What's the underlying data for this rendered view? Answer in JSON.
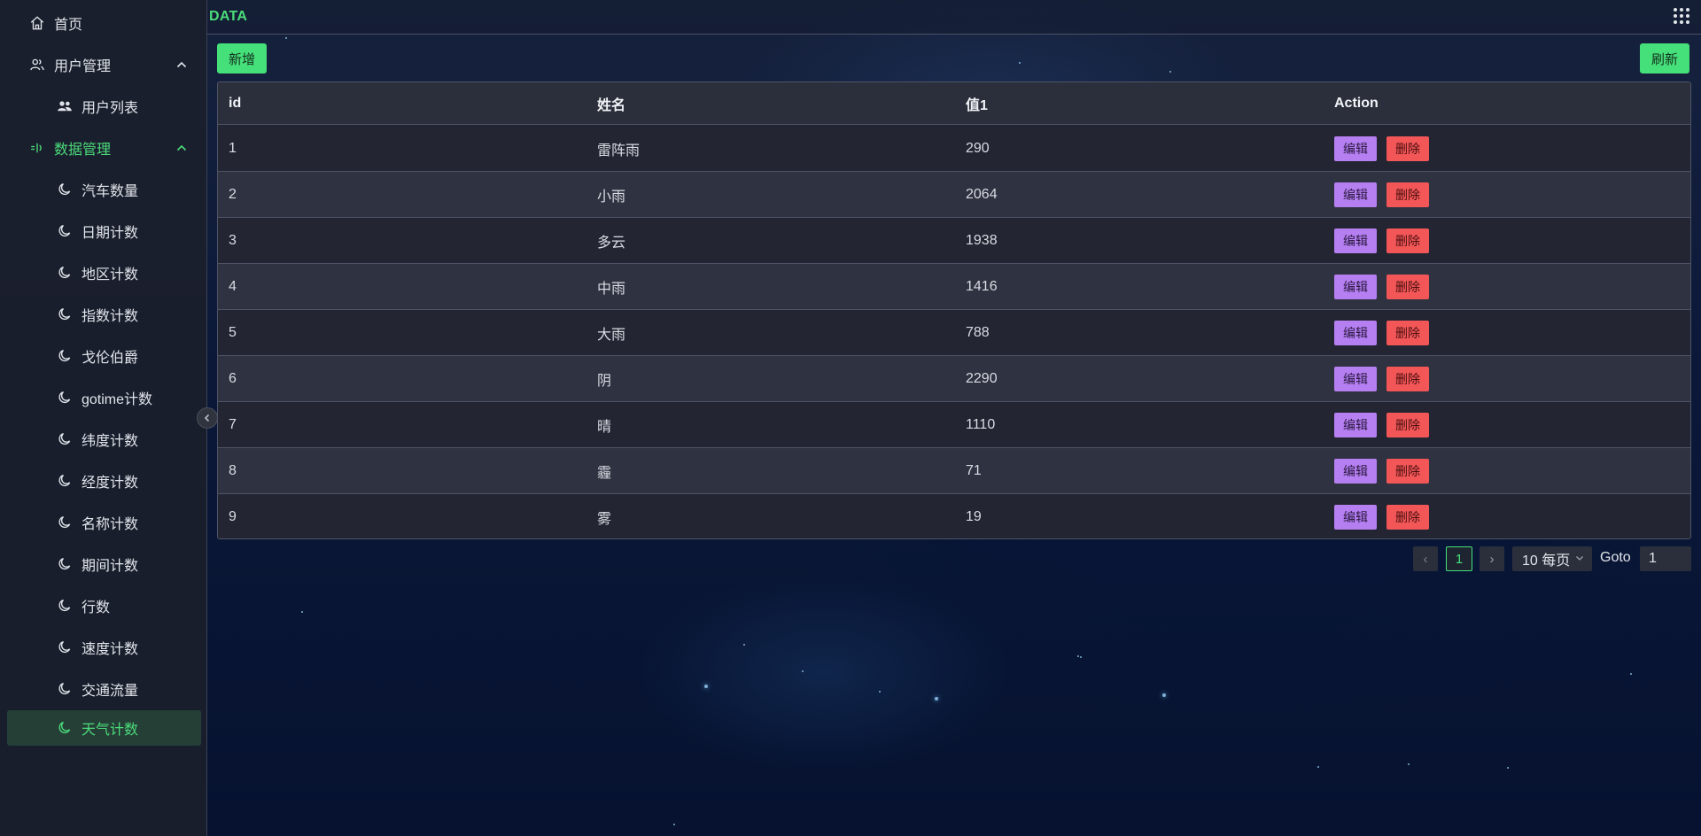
{
  "app": {
    "brand": "DATA"
  },
  "sidebar": {
    "home": {
      "label": "首页",
      "icon": "home-icon"
    },
    "groups": [
      {
        "label": "用户管理",
        "icon": "users-icon",
        "expanded": true,
        "items": [
          {
            "label": "用户列表",
            "icon": "user-group-icon"
          }
        ]
      },
      {
        "label": "数据管理",
        "icon": "data-icon",
        "expanded": true,
        "active": true,
        "items": [
          {
            "label": "汽车数量",
            "icon": "moon-icon"
          },
          {
            "label": "日期计数",
            "icon": "moon-icon"
          },
          {
            "label": "地区计数",
            "icon": "moon-icon"
          },
          {
            "label": "指数计数",
            "icon": "moon-icon"
          },
          {
            "label": "戈伦伯爵",
            "icon": "moon-icon"
          },
          {
            "label": "gotime计数",
            "icon": "moon-icon"
          },
          {
            "label": "纬度计数",
            "icon": "moon-icon"
          },
          {
            "label": "经度计数",
            "icon": "moon-icon"
          },
          {
            "label": "名称计数",
            "icon": "moon-icon"
          },
          {
            "label": "期间计数",
            "icon": "moon-icon"
          },
          {
            "label": "行数",
            "icon": "moon-icon"
          },
          {
            "label": "速度计数",
            "icon": "moon-icon"
          },
          {
            "label": "交通流量",
            "icon": "moon-icon"
          },
          {
            "label": "天气计数",
            "icon": "moon-icon",
            "selected": true
          }
        ]
      }
    ]
  },
  "toolbar": {
    "add_label": "新增",
    "refresh_label": "刷新"
  },
  "table": {
    "columns": [
      "id",
      "姓名",
      "值1",
      "Action"
    ],
    "rows": [
      {
        "id": "1",
        "name": "雷阵雨",
        "value": "290"
      },
      {
        "id": "2",
        "name": "小雨",
        "value": "2064"
      },
      {
        "id": "3",
        "name": "多云",
        "value": "1938"
      },
      {
        "id": "4",
        "name": "中雨",
        "value": "1416"
      },
      {
        "id": "5",
        "name": "大雨",
        "value": "788"
      },
      {
        "id": "6",
        "name": "阴",
        "value": "2290"
      },
      {
        "id": "7",
        "name": "晴",
        "value": "1110"
      },
      {
        "id": "8",
        "name": "霾",
        "value": "71"
      },
      {
        "id": "9",
        "name": "雾",
        "value": "19"
      }
    ],
    "edit_label": "编辑",
    "delete_label": "删除"
  },
  "pagination": {
    "prev": "‹",
    "current_page": "1",
    "next": "›",
    "page_size": "10 每页",
    "goto_label": "Goto",
    "goto_value": "1"
  },
  "colors": {
    "accent": "#45e07a",
    "edit": "#b57ff2",
    "delete": "#f25656",
    "sidebar_bg": "#1b1f2c"
  }
}
